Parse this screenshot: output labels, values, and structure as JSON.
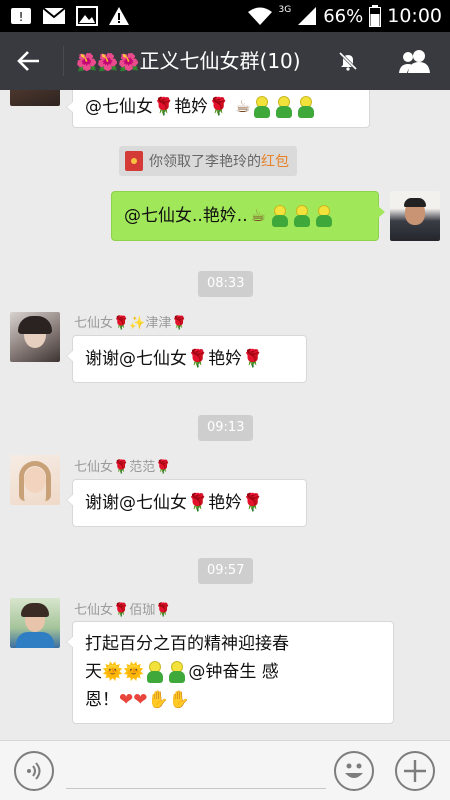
{
  "status_bar": {
    "network": "3G",
    "battery": "66%",
    "time": "10:00"
  },
  "header": {
    "title_flowers": "🌺🌺🌺",
    "title": "正义七仙女群(10)"
  },
  "messages": {
    "top_partial": {
      "mention": "@七仙女",
      "name": "艳妗"
    },
    "system_notice": {
      "text": "你领取了李艳玲的",
      "link": "红包"
    },
    "self_msg": {
      "text_a": "@七仙女..艳妗.."
    },
    "time1": "08:33",
    "m1": {
      "sender_a": "七仙女",
      "sender_b": "津津",
      "text_a": "谢谢@七仙女",
      "text_b": "艳妗"
    },
    "time2": "09:13",
    "m2": {
      "sender_a": "七仙女",
      "sender_b": "范范",
      "text_a": "谢谢@七仙女",
      "text_b": "艳妗"
    },
    "time3": "09:57",
    "m3": {
      "sender_a": "七仙女",
      "sender_b": "佰珈",
      "line1": "打起百分之百的精神迎接春",
      "line2_a": "天",
      "line2_b": "@钟奋生 感",
      "line3_a": "恩！"
    }
  },
  "input": {
    "placeholder": ""
  },
  "colors": {
    "title_bar": "#393a3f",
    "self_bubble": "#a0e75a",
    "link": "#e8832a",
    "background": "#ebebeb"
  },
  "icons": [
    "alert-icon",
    "mail-icon",
    "image-icon",
    "warning-icon",
    "wifi-icon",
    "signal-icon",
    "battery-icon",
    "back-arrow-icon",
    "mute-bell-icon",
    "group-members-icon",
    "voice-icon",
    "emoji-icon",
    "plus-icon"
  ]
}
